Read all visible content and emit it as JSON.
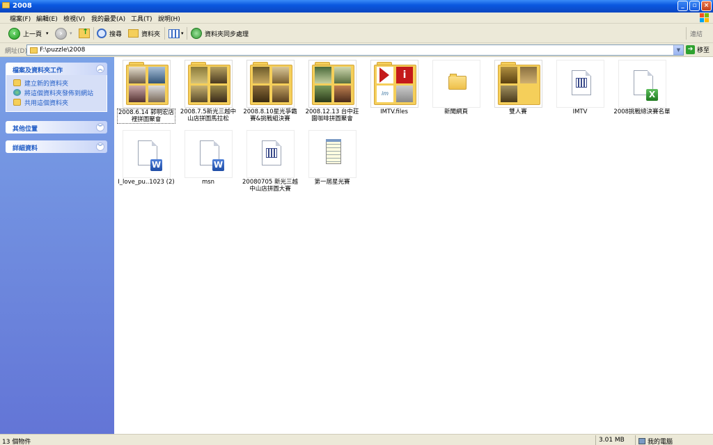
{
  "window": {
    "title": "2008"
  },
  "menu": [
    "檔案(F)",
    "編輯(E)",
    "檢視(V)",
    "我的最愛(A)",
    "工具(T)",
    "說明(H)"
  ],
  "toolbar": {
    "back": "上一頁",
    "search": "搜尋",
    "folders": "資料夾",
    "sync": "資料夾同步處理",
    "links": "連結"
  },
  "address": {
    "label": "網址(D)",
    "path": "F:\\puzzle\\2008",
    "go": "移至"
  },
  "sidebar": {
    "tasks_title": "檔案及資料夾工作",
    "tasks": [
      "建立新的資料夾",
      "將這個資料夾發佈到網站",
      "共用這個資料夾"
    ],
    "other_title": "其他位置",
    "details_title": "詳細資料"
  },
  "files": [
    {
      "name": "2008.6.14 郭明宏店裡拼圖聚會",
      "kind": "photo-folder"
    },
    {
      "name": "2008.7.5新光三越中山店拼圖馬拉松",
      "kind": "photo-folder"
    },
    {
      "name": "2008.8.10星光爭霸賽&挑戰組決賽",
      "kind": "photo-folder"
    },
    {
      "name": "2008.12.13 台中莊園咖啡拼圖聚會",
      "kind": "photo-folder"
    },
    {
      "name": "IMTV.files",
      "kind": "files-folder"
    },
    {
      "name": "新聞網頁",
      "kind": "plain-folder"
    },
    {
      "name": "雙人賽",
      "kind": "photo-folder"
    },
    {
      "name": "IMTV",
      "kind": "calendar-doc"
    },
    {
      "name": "2008挑戰總決賽名單",
      "kind": "excel-doc"
    },
    {
      "name": "I_love_pu..1023 (2)",
      "kind": "word-doc"
    },
    {
      "name": "msn",
      "kind": "word-doc"
    },
    {
      "name": "20080705 新光三越中山店拼圖大賽",
      "kind": "calendar-doc"
    },
    {
      "name": "第一屆星光賽",
      "kind": "notepad-doc"
    }
  ],
  "status": {
    "count": "13 個物件",
    "size": "3.01 MB",
    "location": "我的電腦"
  },
  "colors": {
    "titlebar": "#0a58e0",
    "sidebar": "#7ba2e7",
    "folder": "#f5cf5a",
    "link": "#215dc6"
  }
}
